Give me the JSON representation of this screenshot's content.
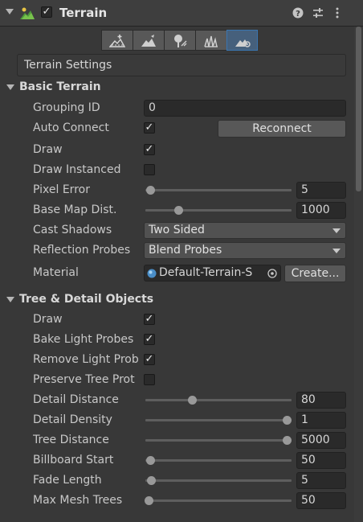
{
  "header": {
    "title": "Terrain",
    "enabled": true,
    "icons": [
      "terrain-component-icon",
      "help-icon",
      "preset-icon",
      "more-vert-icon"
    ]
  },
  "toolbar": {
    "tools": [
      "raise-lower-terrain-icon",
      "paint-trees-icon",
      "paint-details-icon",
      "paint-texture-icon",
      "terrain-settings-icon"
    ],
    "active_index": 4
  },
  "settings_title": "Terrain Settings",
  "basic_terrain": {
    "title": "Basic Terrain",
    "grouping_id": {
      "label": "Grouping ID",
      "value": "0"
    },
    "auto_connect": {
      "label": "Auto Connect",
      "checked": true
    },
    "reconnect_label": "Reconnect",
    "draw": {
      "label": "Draw",
      "checked": true
    },
    "draw_instanced": {
      "label": "Draw Instanced",
      "checked": false
    },
    "pixel_error": {
      "label": "Pixel Error",
      "value": "5",
      "slider": 0.04
    },
    "base_map_dist": {
      "label": "Base Map Dist.",
      "value": "1000",
      "slider": 0.24
    },
    "cast_shadows": {
      "label": "Cast Shadows",
      "value": "Two Sided"
    },
    "reflection_probes": {
      "label": "Reflection Probes",
      "value": "Blend Probes"
    },
    "material": {
      "label": "Material",
      "value": "Default-Terrain-S",
      "create_label": "Create..."
    }
  },
  "tree_detail": {
    "title": "Tree & Detail Objects",
    "draw": {
      "label": "Draw",
      "checked": true
    },
    "bake_light_probes": {
      "label": "Bake Light Probes",
      "checked": true
    },
    "remove_light_probes": {
      "label": "Remove Light Prob",
      "checked": true
    },
    "preserve_tree_proto": {
      "label": "Preserve Tree Prot",
      "checked": false
    },
    "detail_distance": {
      "label": "Detail Distance",
      "value": "80",
      "slider": 0.33
    },
    "detail_density": {
      "label": "Detail Density",
      "value": "1",
      "slider": 1.0
    },
    "tree_distance": {
      "label": "Tree Distance",
      "value": "5000",
      "slider": 1.0
    },
    "billboard_start": {
      "label": "Billboard Start",
      "value": "50",
      "slider": 0.03
    },
    "fade_length": {
      "label": "Fade Length",
      "value": "5",
      "slider": 0.05
    },
    "max_mesh_trees": {
      "label": "Max Mesh Trees",
      "value": "50",
      "slider": 0.02
    }
  },
  "colors": {
    "background": "#383838",
    "active_tool": "#46607c",
    "field": "#2a2a2a"
  }
}
